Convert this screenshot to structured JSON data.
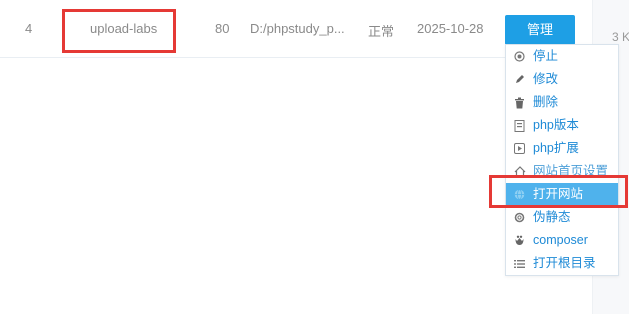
{
  "row": {
    "id": "4",
    "name": "upload-labs",
    "port": "80",
    "path": "D:/phpstudy_p...",
    "status": "正常",
    "date": "2025-10-28",
    "manage_label": "管理"
  },
  "right_column": {
    "size_text": "3 K"
  },
  "menu": {
    "items": [
      {
        "label": "停止",
        "icon": "stop-icon"
      },
      {
        "label": "修改",
        "icon": "edit-icon"
      },
      {
        "label": "删除",
        "icon": "trash-icon"
      },
      {
        "label": "php版本",
        "icon": "php-version-icon"
      },
      {
        "label": "php扩展",
        "icon": "php-extension-icon"
      },
      {
        "label": "网站首页设置",
        "icon": "home-icon"
      },
      {
        "label": "打开网站",
        "icon": "globe-icon",
        "active": true
      },
      {
        "label": "伪静态",
        "icon": "settings-icon"
      },
      {
        "label": "composer",
        "icon": "composer-icon"
      },
      {
        "label": "打开根目录",
        "icon": "list-icon"
      }
    ]
  },
  "colors": {
    "primary": "#1e9fe5",
    "menu_active": "#4fb2ec",
    "highlight": "#e53935",
    "link": "#1e8ad6"
  }
}
